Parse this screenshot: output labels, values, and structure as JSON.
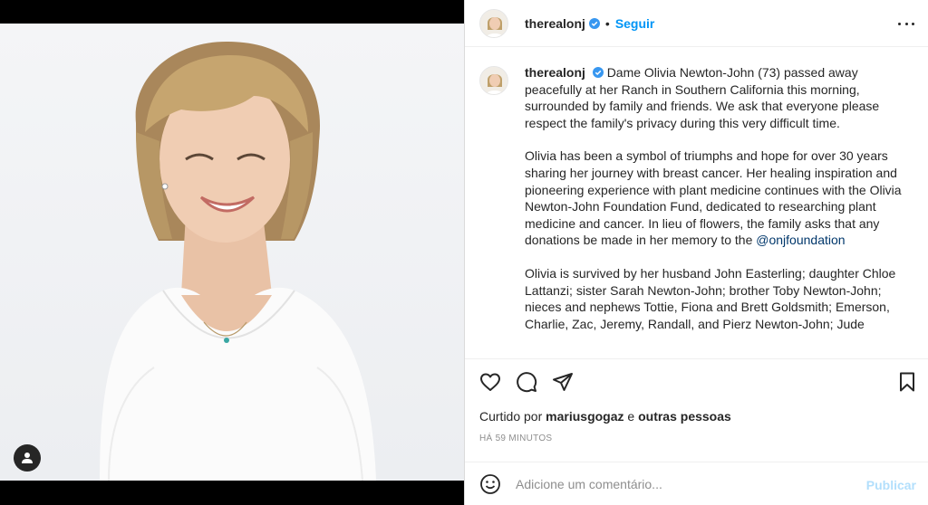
{
  "post": {
    "username": "therealonj",
    "follow_label": "Seguir",
    "separator": "•",
    "caption_paragraphs": [
      "Dame Olivia Newton-John (73) passed away peacefully at her Ranch in Southern California this morning, surrounded by family and friends. We ask that everyone please respect the family's privacy during this very difficult time.",
      "Olivia has been a symbol of triumphs and hope for over 30 years sharing her journey with breast cancer. Her healing inspiration and pioneering experience with plant medicine continues with the Olivia Newton-John Foundation Fund, dedicated to researching plant medicine and cancer. In lieu of flowers, the family asks that any donations be made in her memory to the",
      "Olivia is survived by her husband John Easterling; daughter Chloe Lattanzi; sister Sarah Newton-John; brother Toby Newton-John; nieces and nephews Tottie, Fiona and Brett Goldsmith; Emerson, Charlie, Zac, Jeremy, Randall, and Pierz Newton-John; Jude"
    ],
    "mention": "@onjfoundation",
    "likes_prefix": "Curtido por",
    "likes_user": "mariusgogaz",
    "likes_and": "e",
    "likes_others": "outras pessoas",
    "time_ago": "HÁ 59 MINUTOS",
    "comment_placeholder": "Adicione um comentário...",
    "publish_label": "Publicar"
  },
  "colors": {
    "accent": "#0095f6",
    "verified": "#3897f0",
    "publish_disabled": "#b2dffc",
    "link": "#00376b"
  },
  "icons": [
    "verified-badge-icon",
    "more-options-icon",
    "heart-icon",
    "comment-icon",
    "share-icon",
    "bookmark-icon",
    "emoji-icon",
    "user-tag-icon"
  ]
}
